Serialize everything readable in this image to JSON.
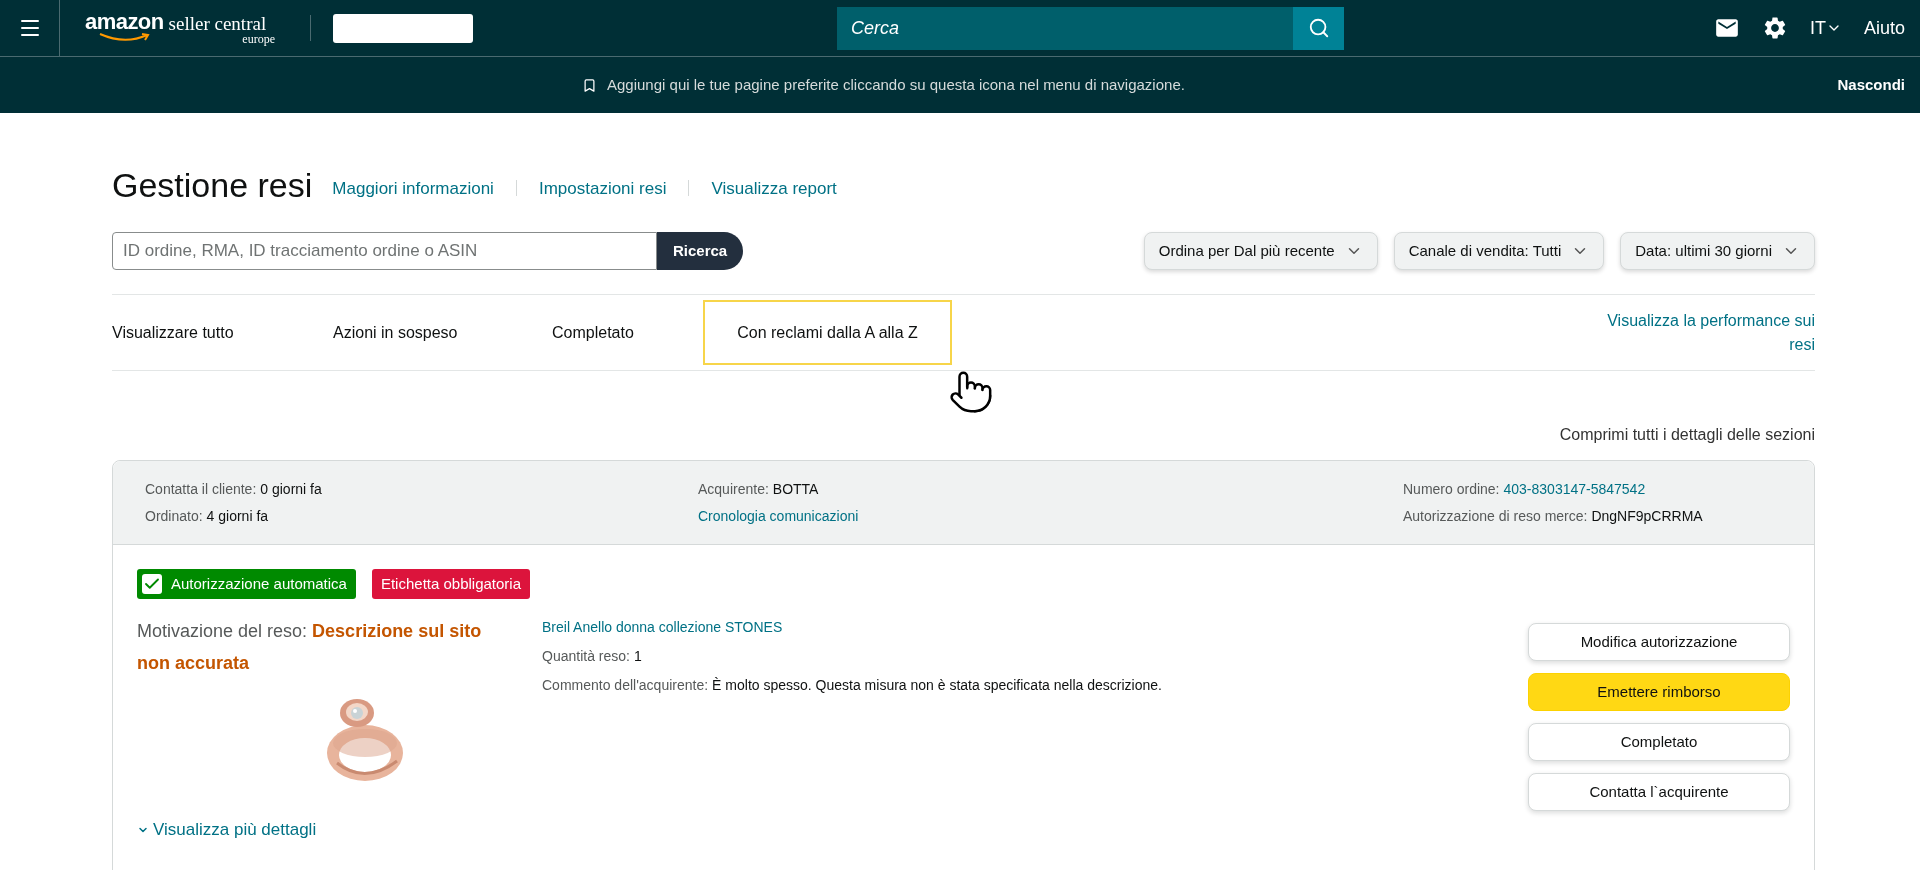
{
  "top_bar": {
    "logo": {
      "brand": "amazon",
      "product": "seller central",
      "region": "europe"
    },
    "search": {
      "placeholder": "Cerca"
    },
    "language": "IT",
    "help": "Aiuto"
  },
  "banner": {
    "message": "Aggiungi qui le tue pagine preferite cliccando su questa icona nel menu di navigazione.",
    "hide": "Nascondi"
  },
  "page": {
    "title": "Gestione resi",
    "links": [
      "Maggiori informazioni",
      "Impostazioni resi",
      "Visualizza report"
    ]
  },
  "search": {
    "placeholder": "ID ordine, RMA, ID tracciamento ordine o ASIN",
    "button": "Ricerca"
  },
  "filters": [
    "Ordina per Dal più recente",
    "Canale di vendita: Tutti",
    "Data: ultimi 30 giorni"
  ],
  "tabs": [
    {
      "label": "Visualizzare tutto",
      "highlighted": false
    },
    {
      "label": "Azioni in sospeso",
      "highlighted": false
    },
    {
      "label": "Completato",
      "highlighted": false
    },
    {
      "label": "Con reclami dalla A alla Z",
      "highlighted": true
    }
  ],
  "performance_link": "Visualizza la performance sui resi",
  "collapse_link": "Comprimi tutti i dettagli delle sezioni",
  "return_card": {
    "header_columns": [
      [
        {
          "label": "Contatta il cliente:",
          "value": "0 giorni fa",
          "kind": "text"
        },
        {
          "label": "Ordinato:",
          "value": "4 giorni fa",
          "kind": "text"
        }
      ],
      [
        {
          "label": "Acquirente:",
          "value": "BOTTA",
          "kind": "text"
        },
        {
          "value": "Cronologia comunicazioni",
          "kind": "link"
        }
      ],
      [
        {
          "label": "Numero ordine:",
          "value": "403-8303147-5847542",
          "kind": "link"
        },
        {
          "label": "Autorizzazione di reso merce:",
          "value": "DngNF9pCRRMA",
          "kind": "text"
        }
      ]
    ],
    "badges": [
      {
        "label": "Autorizzazione automatica",
        "color": "#008a00",
        "checked": true
      },
      {
        "label": "Etichetta obbligatoria",
        "color": "#dc143c",
        "checked": false
      }
    ],
    "reason": "Motivazione del reso: **Descrizione sul sito non accurata**",
    "product": {
      "name": "Breil Anello donna collezione STONES",
      "details": [
        {
          "label": "Quantità reso:",
          "value": "1"
        },
        {
          "label": "Commento dell'acquirente:",
          "value": "È molto spesso. Questa misura non è stata specificata nella descrizione."
        }
      ]
    },
    "actions": [
      {
        "label": "Modifica autorizzazione",
        "primary": false
      },
      {
        "label": "Emettere rimborso",
        "primary": true
      },
      {
        "label": "Completato",
        "primary": false
      },
      {
        "label": "Contatta l`acquirente",
        "primary": false
      }
    ],
    "more_details": "Visualizza più dettagli"
  }
}
